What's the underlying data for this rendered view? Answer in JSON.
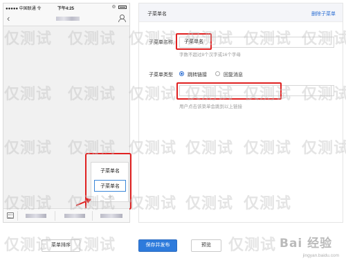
{
  "phone": {
    "status": {
      "carrier": "●●●●● 中国联通 令",
      "time": "下午4:25",
      "location_icon": "◎"
    },
    "nav": {
      "back_icon": "‹"
    },
    "submenu": {
      "items": [
        "子菜单名",
        "子菜单名"
      ],
      "add_icon": "+"
    }
  },
  "editor": {
    "header_title": "子菜单名",
    "delete_link": "删除子菜单",
    "name_label": "子菜单名称",
    "name_value": "子菜单名",
    "name_hint": "字数不超过8个汉字或16个字母",
    "type_label": "子菜单类型",
    "type_options": [
      "跳转链接",
      "回复消息"
    ],
    "type_selected": "跳转链接",
    "link_hint": "用户点击该菜单会跳到以上链接"
  },
  "footer": {
    "sort_button": "菜单排序",
    "save_publish_button": "保存并发布",
    "preview_button": "预览"
  },
  "watermark": {
    "text": "仅测试",
    "brand": "Bai 经验",
    "brand_sub": "jingyan.baidu.com"
  },
  "colors": {
    "accent": "#2e7bdc",
    "highlight": "#e02020",
    "link": "#2d6fd3"
  }
}
